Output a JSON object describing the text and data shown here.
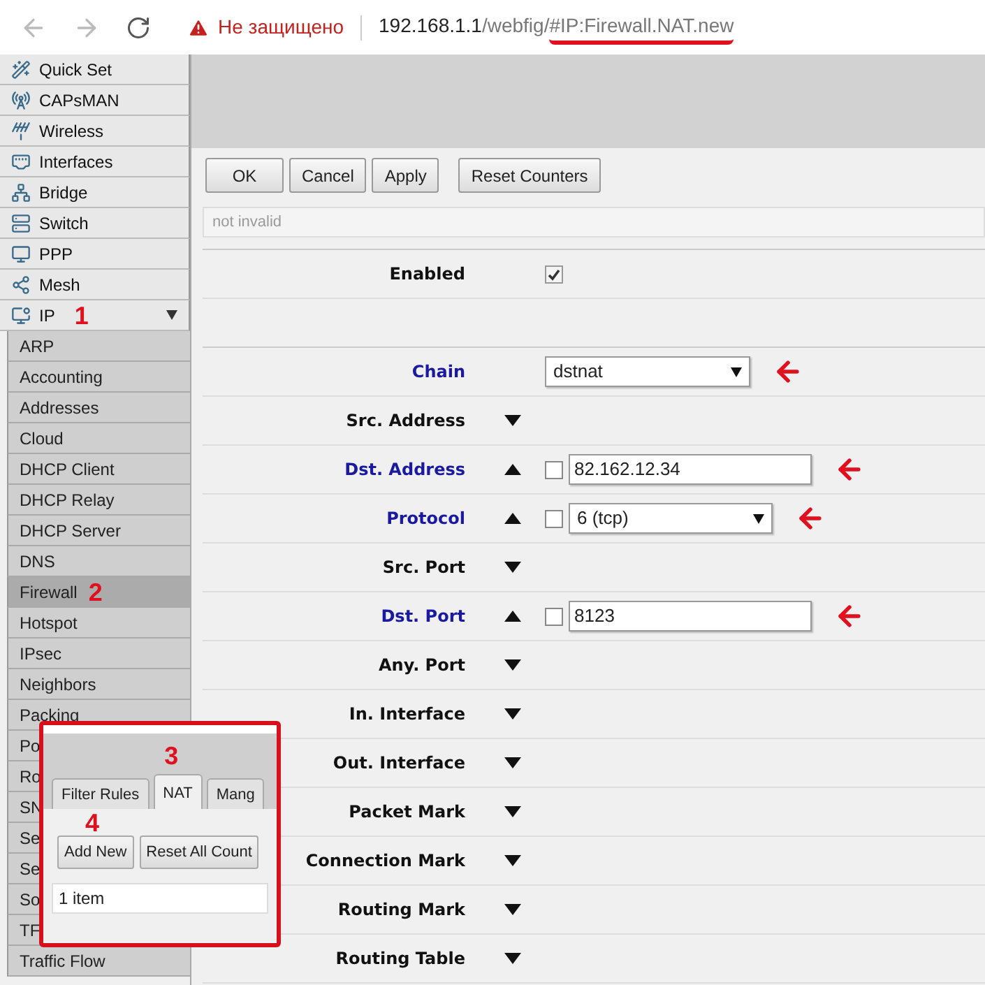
{
  "browser": {
    "security": "Не защищено",
    "url": [
      {
        "text": "192.168.1.1",
        "dim": false,
        "underlined": false
      },
      {
        "text": "/webfig/",
        "dim": true,
        "underlined": false
      },
      {
        "text": "#IP:Firewall.NAT.new",
        "dim": true,
        "underlined": true
      }
    ]
  },
  "sidebar": {
    "items": [
      {
        "label": "Quick Set"
      },
      {
        "label": "CAPsMAN"
      },
      {
        "label": "Wireless"
      },
      {
        "label": "Interfaces"
      },
      {
        "label": "Bridge"
      },
      {
        "label": "Switch"
      },
      {
        "label": "PPP"
      },
      {
        "label": "Mesh"
      },
      {
        "label": "IP",
        "annotation": "1",
        "expanded": true,
        "children": [
          {
            "label": "ARP",
            "selected": false
          },
          {
            "label": "Accounting",
            "selected": false
          },
          {
            "label": "Addresses",
            "selected": false
          },
          {
            "label": "Cloud",
            "selected": false
          },
          {
            "label": "DHCP Client",
            "selected": false
          },
          {
            "label": "DHCP Relay",
            "selected": false
          },
          {
            "label": "DHCP Server",
            "selected": false
          },
          {
            "label": "DNS",
            "selected": false
          },
          {
            "label": "Firewall",
            "selected": true,
            "annotation": "2"
          },
          {
            "label": "Hotspot",
            "selected": false
          },
          {
            "label": "IPsec",
            "selected": false
          },
          {
            "label": "Neighbors",
            "selected": false
          },
          {
            "label": "Packing",
            "selected": false
          },
          {
            "label": "Po",
            "selected": false
          },
          {
            "label": "Ro",
            "selected": false
          },
          {
            "label": "SN",
            "selected": false
          },
          {
            "label": "Se",
            "selected": false
          },
          {
            "label": "Se",
            "selected": false
          },
          {
            "label": "So",
            "selected": false
          },
          {
            "label": "TF",
            "selected": false
          },
          {
            "label": "Traffic Flow",
            "selected": false
          }
        ]
      }
    ]
  },
  "toolbar": {
    "buttons": [
      "OK",
      "Cancel",
      "Apply",
      "Reset Counters"
    ]
  },
  "comment": {
    "placeholder": "not invalid"
  },
  "form": {
    "rows": [
      {
        "kind": "checkbox",
        "label": "Enabled",
        "checked": true,
        "modified": false,
        "annotated": false
      },
      {
        "kind": "spacer"
      },
      {
        "kind": "select",
        "label": "Chain",
        "value": "dstnat",
        "modified": true,
        "annotated": true
      },
      {
        "kind": "toggle",
        "label": "Src. Address",
        "expanded": false,
        "modified": false
      },
      {
        "kind": "input",
        "label": "Dst. Address",
        "expanded": true,
        "negated": false,
        "value": "82.162.12.34",
        "modified": true,
        "annotated": true
      },
      {
        "kind": "select",
        "label": "Protocol",
        "expanded": true,
        "negated": false,
        "value": "6 (tcp)",
        "modified": true,
        "annotated": true
      },
      {
        "kind": "toggle",
        "label": "Src. Port",
        "expanded": false,
        "modified": false
      },
      {
        "kind": "input",
        "label": "Dst. Port",
        "expanded": true,
        "negated": false,
        "value": "8123",
        "modified": true,
        "annotated": true
      },
      {
        "kind": "toggle",
        "label": "Any. Port",
        "expanded": false,
        "modified": false
      },
      {
        "kind": "toggle",
        "label": "In. Interface",
        "expanded": false,
        "modified": false
      },
      {
        "kind": "toggle",
        "label": "Out. Interface",
        "expanded": false,
        "modified": false
      },
      {
        "kind": "toggle",
        "label": "Packet Mark",
        "expanded": false,
        "modified": false
      },
      {
        "kind": "toggle",
        "label": "Connection Mark",
        "expanded": false,
        "modified": false
      },
      {
        "kind": "toggle",
        "label": "Routing Mark",
        "expanded": false,
        "modified": false
      },
      {
        "kind": "toggle",
        "label": "Routing Table",
        "expanded": false,
        "modified": false
      }
    ]
  },
  "inset": {
    "tabs": [
      {
        "label": "Filter Rules",
        "selected": false
      },
      {
        "label": "NAT",
        "selected": true,
        "annotation": "3"
      },
      {
        "label": "Mang",
        "selected": false
      }
    ],
    "buttons": [
      {
        "label": "Add New",
        "annotation": "4"
      },
      {
        "label": "Reset All Count"
      }
    ],
    "status": "1 item"
  }
}
